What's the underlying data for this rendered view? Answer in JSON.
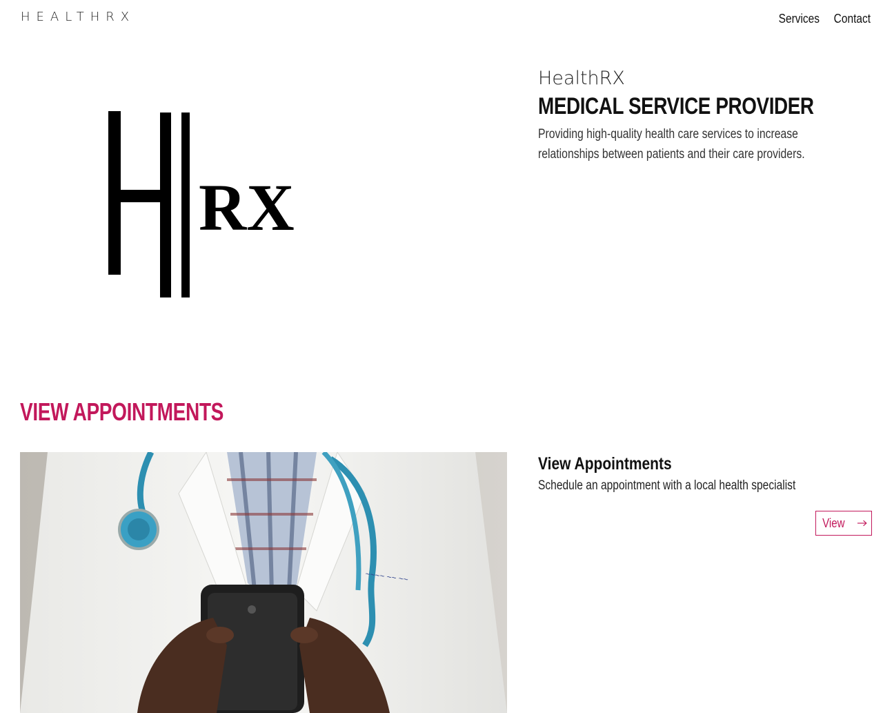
{
  "header": {
    "brand": "HEALTHRX",
    "nav": [
      {
        "label": "Services"
      },
      {
        "label": "Contact"
      }
    ]
  },
  "hero": {
    "logo_text": "RX",
    "name": "HealthRX",
    "title": "MEDICAL SERVICE PROVIDER",
    "description": "Providing high-quality health care services to increase relationships between patients and their care providers."
  },
  "appointments": {
    "heading": "VIEW APPOINTMENTS",
    "card_title": "View Appointments",
    "card_description": "Schedule an appointment with a local health specialist",
    "button_label": "View",
    "button_icon": "arrow-right-icon",
    "photo_alt": "doctor-with-phone"
  },
  "colors": {
    "accent": "#c2185b",
    "text": "#111111",
    "background": "#ffffff"
  }
}
